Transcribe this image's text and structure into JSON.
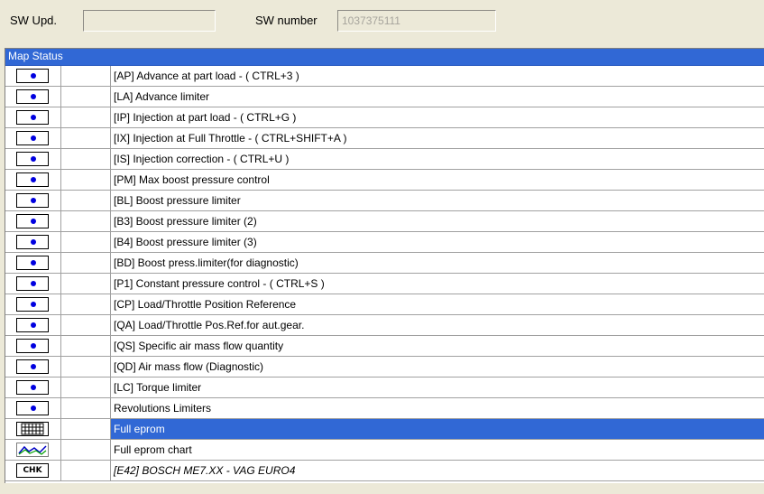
{
  "topbar": {
    "sw_upd_label": "SW Upd.",
    "sw_upd_value": "",
    "sw_number_label": "SW number",
    "sw_number_value": "1037375111"
  },
  "panel": {
    "header": "Map Status",
    "rows": [
      {
        "icon": "status-dot-icon",
        "label": "[AP] Advance at part load - ( CTRL+3 )"
      },
      {
        "icon": "status-dot-icon",
        "label": "[LA] Advance limiter"
      },
      {
        "icon": "status-dot-icon",
        "label": "[IP] Injection at part load - ( CTRL+G )"
      },
      {
        "icon": "status-dot-icon",
        "label": "[IX] Injection at Full Throttle - ( CTRL+SHIFT+A )"
      },
      {
        "icon": "status-dot-icon",
        "label": "[IS] Injection correction - ( CTRL+U )"
      },
      {
        "icon": "status-dot-icon",
        "label": "[PM] Max boost pressure control"
      },
      {
        "icon": "status-dot-icon",
        "label": "[BL] Boost pressure limiter"
      },
      {
        "icon": "status-dot-icon",
        "label": "[B3] Boost pressure limiter (2)"
      },
      {
        "icon": "status-dot-icon",
        "label": "[B4] Boost pressure limiter (3)"
      },
      {
        "icon": "status-dot-icon",
        "label": "[BD] Boost press.limiter(for diagnostic)"
      },
      {
        "icon": "status-dot-icon",
        "label": "[P1] Constant pressure control - ( CTRL+S )"
      },
      {
        "icon": "status-dot-icon",
        "label": "[CP] Load/Throttle Position Reference"
      },
      {
        "icon": "status-dot-icon",
        "label": "[QA] Load/Throttle Pos.Ref.for aut.gear."
      },
      {
        "icon": "status-dot-icon",
        "label": "[QS] Specific air mass flow quantity"
      },
      {
        "icon": "status-dot-icon",
        "label": "[QD] Air mass flow (Diagnostic)"
      },
      {
        "icon": "status-dot-icon",
        "label": "[LC] Torque limiter"
      },
      {
        "icon": "status-dot-icon",
        "label": "Revolutions Limiters"
      },
      {
        "icon": "table-grid-icon",
        "label": "Full eprom",
        "selected": true
      },
      {
        "icon": "line-chart-icon",
        "label": "Full eprom chart"
      },
      {
        "icon": "checksum-icon",
        "icon_text": "CHK",
        "label": "[E42] BOSCH ME7.XX - VAG EURO4",
        "italic": true
      }
    ]
  },
  "colors": {
    "selection": "#3168d5",
    "dot": "#0000e0",
    "window_bg": "#ece9d8"
  }
}
